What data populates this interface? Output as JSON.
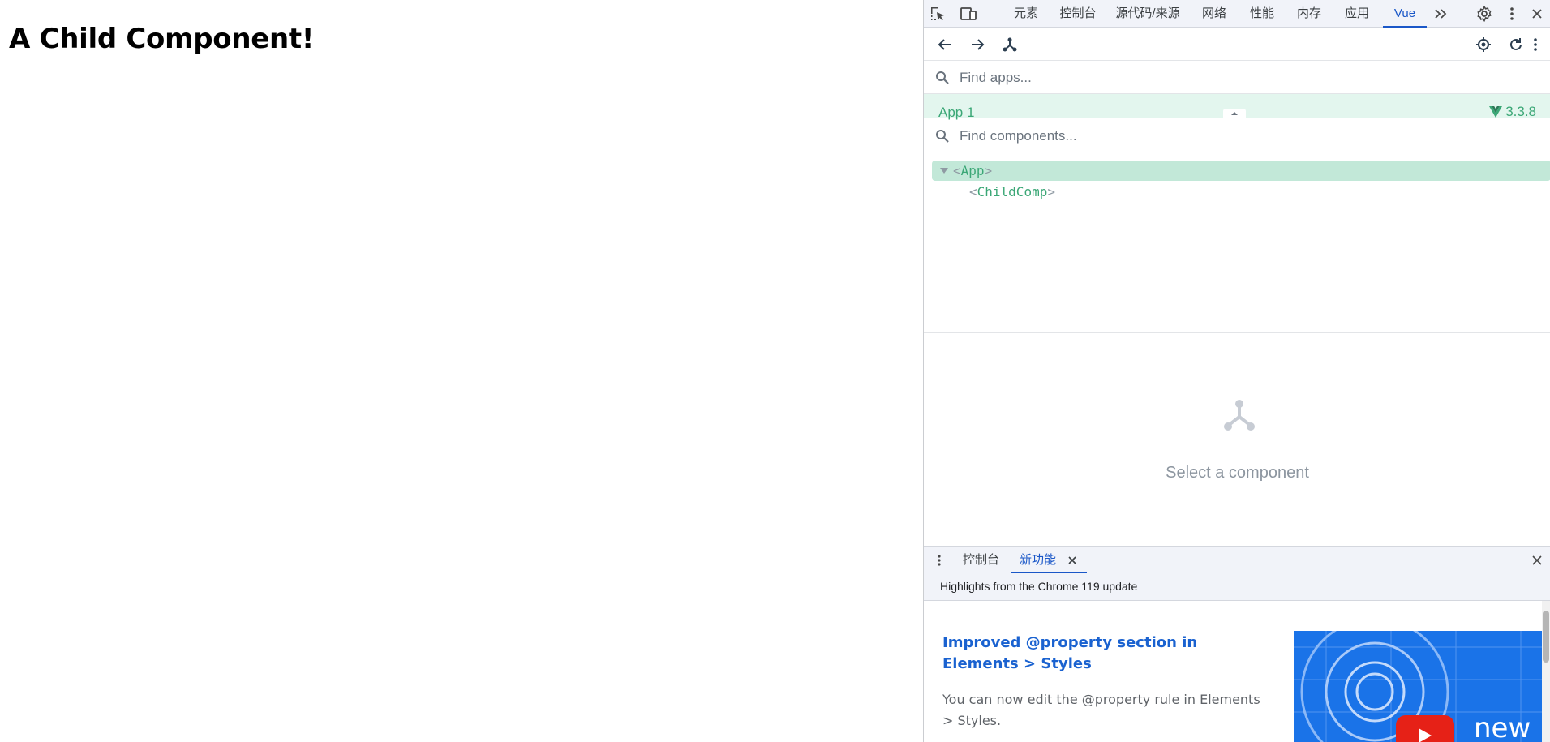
{
  "page": {
    "heading": "A Child Component!"
  },
  "devtools": {
    "tabs": [
      {
        "label": "元素"
      },
      {
        "label": "控制台"
      },
      {
        "label": "源代码/来源"
      },
      {
        "label": "网络"
      },
      {
        "label": "性能"
      },
      {
        "label": "内存"
      },
      {
        "label": "应用"
      },
      {
        "label": "Vue"
      }
    ],
    "active_tab": "Vue",
    "tabbar_icons": [
      "inspect-element-icon",
      "device-toolbar-icon",
      "more-tabs-chevron-icon",
      "settings-gear-icon",
      "kebab-menu-icon",
      "close-icon"
    ],
    "accent_color": "#1a57c8"
  },
  "vue": {
    "toolbar_icons": [
      "back-arrow-icon",
      "forward-arrow-icon",
      "component-tree-icon",
      "select-target-icon",
      "refresh-icon",
      "kebab-menu-icon"
    ],
    "apps_search": {
      "placeholder": "Find apps...",
      "value": ""
    },
    "app": {
      "name": "App 1",
      "version": "3.3.8"
    },
    "components_search": {
      "placeholder": "Find components...",
      "value": ""
    },
    "tree": [
      {
        "name": "App",
        "expanded": true,
        "selected": true
      },
      {
        "name": "ChildComp",
        "expanded": false,
        "selected": false
      }
    ],
    "empty_state": {
      "text": "Select a component"
    },
    "brand_color": "#3ba776"
  },
  "drawer": {
    "tabs": [
      {
        "label": "控制台"
      },
      {
        "label": "新功能"
      }
    ],
    "active_tab": "新功能",
    "highlights_text": "Highlights from the Chrome 119 update",
    "feature": {
      "title": "Improved @property section in Elements > Styles",
      "description": "You can now edit the @property rule in Elements > Styles.",
      "thumbnail_text": "new"
    }
  }
}
